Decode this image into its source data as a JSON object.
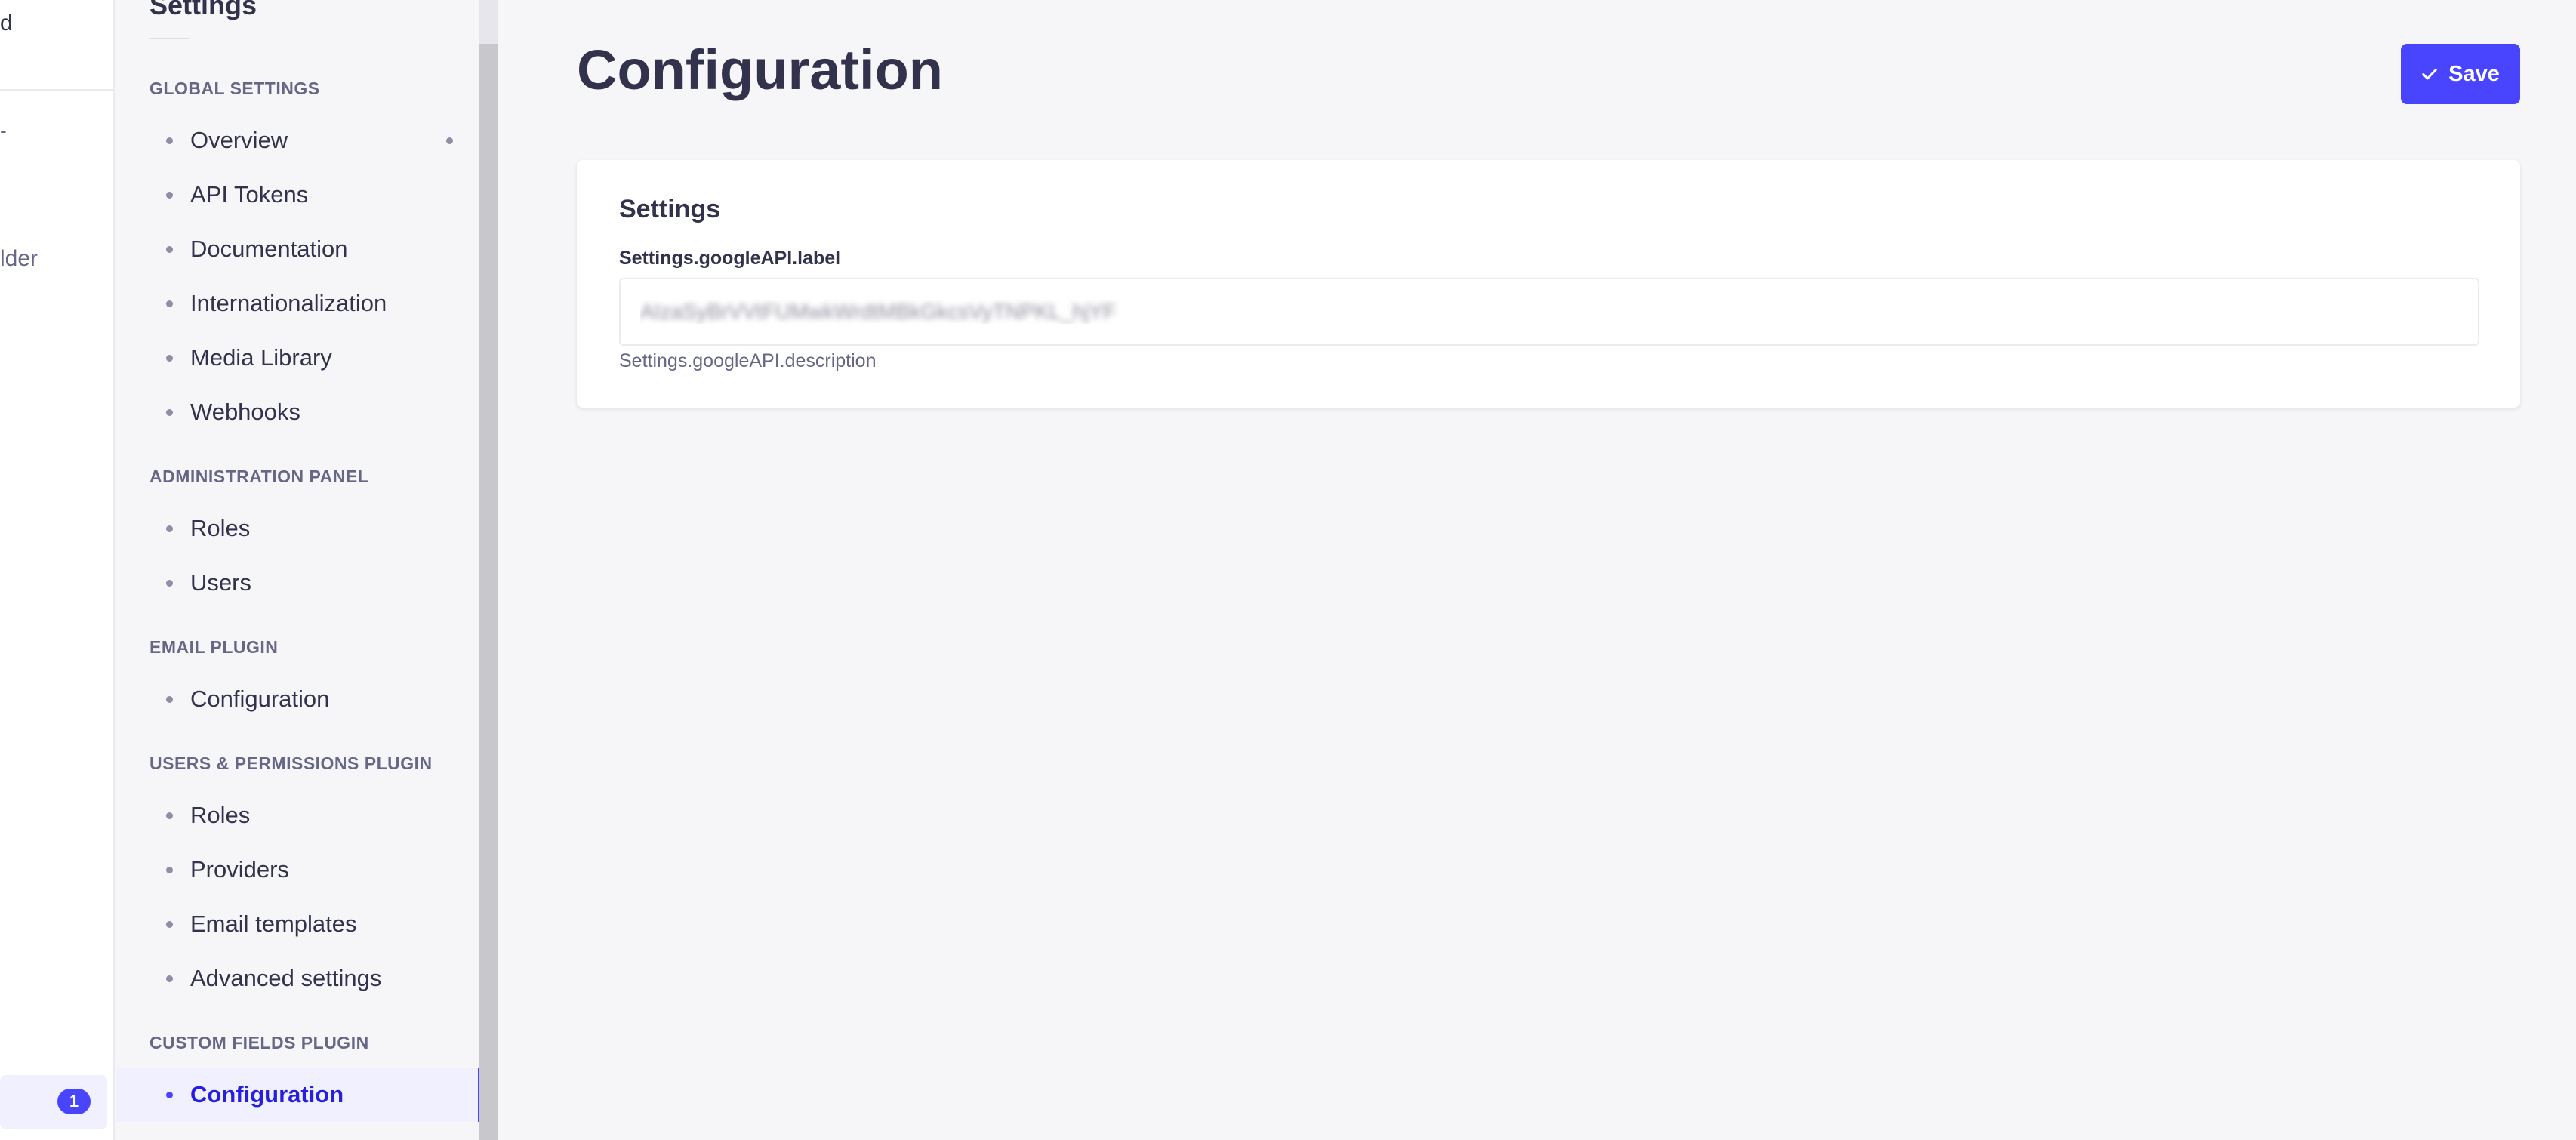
{
  "main_nav": {
    "brand_fragment": "d",
    "nav_fragment_1": "-",
    "nav_fragment_2": "lder",
    "badge_count": "1"
  },
  "settings_nav": {
    "title": "Settings",
    "sections": [
      {
        "label": "GLOBAL SETTINGS",
        "items": [
          "Overview",
          "API Tokens",
          "Documentation",
          "Internationalization",
          "Media Library",
          "Webhooks"
        ]
      },
      {
        "label": "ADMINISTRATION PANEL",
        "items": [
          "Roles",
          "Users"
        ]
      },
      {
        "label": "EMAIL PLUGIN",
        "items": [
          "Configuration"
        ]
      },
      {
        "label": "USERS & PERMISSIONS PLUGIN",
        "items": [
          "Roles",
          "Providers",
          "Email templates",
          "Advanced settings"
        ]
      },
      {
        "label": "CUSTOM FIELDS PLUGIN",
        "items": [
          "Configuration"
        ]
      }
    ]
  },
  "header": {
    "title": "Configuration",
    "save_label": "Save"
  },
  "settings_card": {
    "title": "Settings",
    "field_label": "Settings.googleAPI.label",
    "field_value": "AIzaSyBrVVtFUMwkWrdtMBkGkcsVyTNPKL_hjYF",
    "field_hint": "Settings.googleAPI.description"
  },
  "colors": {
    "accent": "#4945ff",
    "background": "#f6f6f9"
  }
}
